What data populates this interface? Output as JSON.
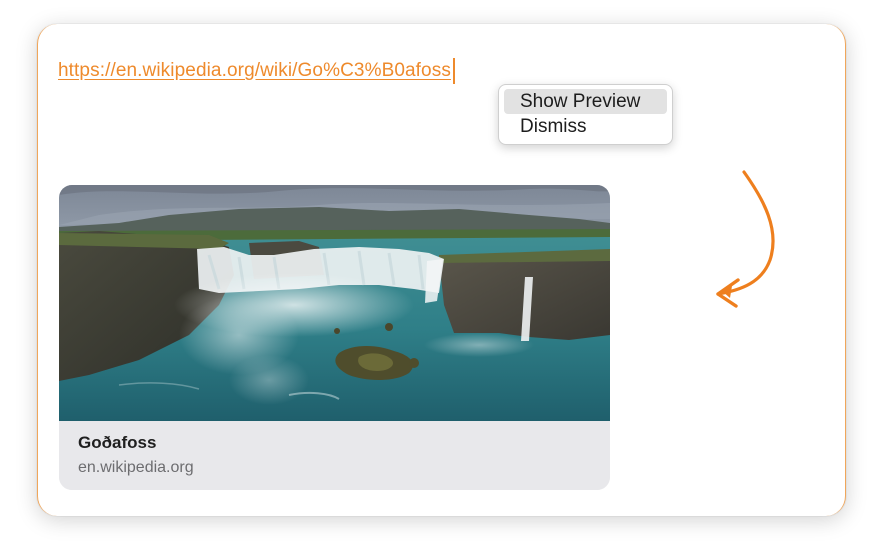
{
  "editor": {
    "url_text": "https://en.wikipedia.org/wiki/Go%C3%B0afoss"
  },
  "context_menu": {
    "items": [
      {
        "label": "Show Preview",
        "highlighted": true
      },
      {
        "label": "Dismiss",
        "highlighted": false
      }
    ]
  },
  "preview": {
    "title": "Goðafoss",
    "domain": "en.wikipedia.org",
    "image_subject": "waterfall photo"
  },
  "annotation": {
    "icon": "hand-drawn-curved-arrow-icon",
    "color": "#ee7f1e"
  },
  "colors": {
    "link": "#ee8a2c",
    "card_footer": "#e8e8eb",
    "menu_highlight": "#e2e2e2"
  }
}
